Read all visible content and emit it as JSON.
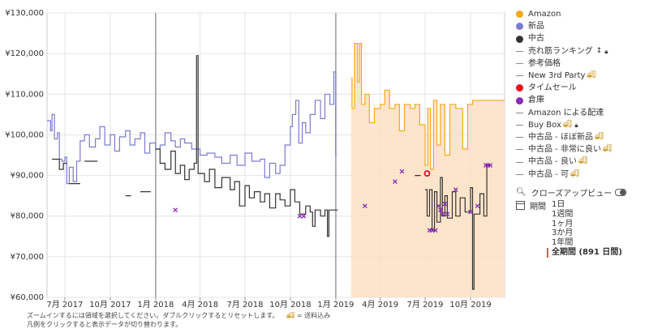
{
  "chart_data": {
    "type": "line",
    "yaxis": {
      "ticks": [
        60000,
        70000,
        80000,
        90000,
        100000,
        110000,
        120000,
        130000
      ],
      "tick_labels": [
        "¥60,000",
        "¥70,000",
        "¥80,000",
        "¥90,000",
        "¥100,000",
        "¥110,000",
        "¥120,000",
        "¥130,000"
      ],
      "ylim": [
        60000,
        130000
      ]
    },
    "xaxis": {
      "start": "2017-05-26",
      "end": "2019-12-09",
      "tick_dates": [
        "2017-07-01",
        "2017-10-01",
        "2018-01-01",
        "2018-04-01",
        "2018-07-01",
        "2018-10-01",
        "2019-01-01",
        "2019-04-01",
        "2019-07-01",
        "2019-10-01"
      ],
      "tick_labels": [
        "7月 2017",
        "10月 2017",
        "1月 2018",
        "4月 2018",
        "7月 2018",
        "10月 2018",
        "1月 2019",
        "4月 2019",
        "7月 2019",
        "10月 2019"
      ],
      "year_separators": [
        "2018-01-01",
        "2019-01-01"
      ]
    },
    "grid": true,
    "series": [
      {
        "name": "新品",
        "color": "#7b7bd1",
        "points": [
          [
            "2017-05-26",
            103500
          ],
          [
            "2017-06-02",
            101000
          ],
          [
            "2017-06-05",
            105000
          ],
          [
            "2017-06-10",
            99000
          ],
          [
            "2017-06-16",
            100500
          ],
          [
            "2017-06-20",
            94000
          ],
          [
            "2017-06-25",
            93500
          ],
          [
            "2017-07-01",
            94500
          ],
          [
            "2017-07-05",
            88000
          ],
          [
            "2017-07-10",
            92000
          ],
          [
            "2017-07-18",
            88500
          ],
          [
            "2017-07-25",
            93500
          ],
          [
            "2017-08-01",
            98500
          ],
          [
            "2017-08-10",
            100000
          ],
          [
            "2017-08-20",
            97000
          ],
          [
            "2017-09-01",
            99000
          ],
          [
            "2017-09-10",
            102000
          ],
          [
            "2017-09-20",
            97500
          ],
          [
            "2017-10-01",
            100000
          ],
          [
            "2017-10-10",
            96000
          ],
          [
            "2017-10-20",
            99500
          ],
          [
            "2017-11-01",
            101000
          ],
          [
            "2017-11-10",
            97500
          ],
          [
            "2017-11-20",
            99000
          ],
          [
            "2017-12-01",
            100500
          ],
          [
            "2017-12-10",
            95500
          ],
          [
            "2017-12-20",
            98000
          ],
          [
            "2018-01-01",
            96500
          ],
          [
            "2018-01-10",
            97500
          ],
          [
            "2018-01-20",
            100500
          ],
          [
            "2018-02-01",
            98500
          ],
          [
            "2018-02-10",
            97000
          ],
          [
            "2018-02-20",
            99000
          ],
          [
            "2018-03-01",
            98000
          ],
          [
            "2018-03-15",
            96500
          ],
          [
            "2018-04-01",
            95000
          ],
          [
            "2018-04-15",
            95500
          ],
          [
            "2018-05-01",
            94500
          ],
          [
            "2018-05-15",
            93000
          ],
          [
            "2018-06-01",
            95000
          ],
          [
            "2018-06-15",
            92500
          ],
          [
            "2018-07-01",
            95500
          ],
          [
            "2018-07-15",
            93500
          ],
          [
            "2018-08-01",
            94000
          ],
          [
            "2018-08-10",
            89500
          ],
          [
            "2018-08-20",
            93000
          ],
          [
            "2018-09-01",
            90500
          ],
          [
            "2018-09-10",
            92500
          ],
          [
            "2018-09-20",
            97500
          ],
          [
            "2018-10-01",
            102000
          ],
          [
            "2018-10-05",
            105000
          ],
          [
            "2018-10-12",
            108500
          ],
          [
            "2018-10-18",
            98000
          ],
          [
            "2018-10-25",
            103000
          ],
          [
            "2018-11-01",
            100500
          ],
          [
            "2018-11-10",
            105000
          ],
          [
            "2018-11-20",
            108500
          ],
          [
            "2018-12-01",
            104000
          ],
          [
            "2018-12-10",
            110000
          ],
          [
            "2018-12-20",
            107500
          ],
          [
            "2018-12-28",
            115500
          ],
          [
            "2019-01-01",
            95000
          ],
          [
            "2019-01-03",
            95000
          ]
        ]
      },
      {
        "name": "中古",
        "color": "#333333",
        "points": [
          [
            "2017-06-05",
            94000
          ],
          [
            "2017-06-20",
            91500
          ],
          [
            "2017-06-28",
            93000
          ],
          [
            "2017-07-05",
            null
          ],
          [
            "2017-07-10",
            88000
          ],
          [
            "2017-07-25",
            88000
          ],
          [
            "2017-08-01",
            null
          ],
          [
            "2017-08-10",
            93500
          ],
          [
            "2017-09-01",
            93500
          ],
          [
            "2017-09-05",
            null
          ],
          [
            "2017-11-01",
            85000
          ],
          [
            "2017-11-10",
            85000
          ],
          [
            "2017-11-12",
            null
          ],
          [
            "2017-12-01",
            86000
          ],
          [
            "2017-12-20",
            86000
          ],
          [
            "2017-12-22",
            null
          ],
          [
            "2018-01-01",
            96500
          ],
          [
            "2018-01-10",
            93000
          ],
          [
            "2018-01-20",
            91500
          ],
          [
            "2018-02-01",
            96000
          ],
          [
            "2018-02-10",
            90500
          ],
          [
            "2018-02-20",
            92500
          ],
          [
            "2018-03-01",
            89000
          ],
          [
            "2018-03-10",
            91500
          ],
          [
            "2018-03-20",
            93000
          ],
          [
            "2018-03-25",
            119500
          ],
          [
            "2018-03-28",
            90500
          ],
          [
            "2018-04-10",
            88500
          ],
          [
            "2018-04-20",
            91500
          ],
          [
            "2018-05-01",
            87000
          ],
          [
            "2018-05-15",
            89500
          ],
          [
            "2018-06-01",
            86500
          ],
          [
            "2018-06-10",
            88500
          ],
          [
            "2018-06-20",
            82500
          ],
          [
            "2018-07-01",
            87500
          ],
          [
            "2018-07-10",
            84500
          ],
          [
            "2018-07-20",
            86000
          ],
          [
            "2018-08-01",
            83500
          ],
          [
            "2018-08-10",
            85500
          ],
          [
            "2018-08-20",
            82000
          ],
          [
            "2018-09-01",
            85500
          ],
          [
            "2018-09-10",
            84000
          ],
          [
            "2018-09-20",
            82500
          ],
          [
            "2018-10-01",
            86500
          ],
          [
            "2018-10-10",
            83500
          ],
          [
            "2018-10-20",
            80500
          ],
          [
            "2018-11-01",
            82500
          ],
          [
            "2018-11-10",
            81000
          ],
          [
            "2018-11-15",
            77500
          ],
          [
            "2018-11-20",
            81500
          ],
          [
            "2018-12-01",
            80000
          ],
          [
            "2018-12-10",
            81500
          ],
          [
            "2018-12-15",
            75000
          ],
          [
            "2018-12-18",
            81500
          ],
          [
            "2019-01-01",
            81500
          ],
          [
            "2019-01-05",
            null
          ],
          [
            "2019-06-10",
            90000
          ],
          [
            "2019-06-20",
            90000
          ],
          [
            "2019-06-22",
            null
          ],
          [
            "2019-07-01",
            86500
          ],
          [
            "2019-07-05",
            80000
          ],
          [
            "2019-07-10",
            86500
          ],
          [
            "2019-07-15",
            76500
          ],
          [
            "2019-07-20",
            86000
          ],
          [
            "2019-07-25",
            78500
          ],
          [
            "2019-08-01",
            89500
          ],
          [
            "2019-08-05",
            80000
          ],
          [
            "2019-08-10",
            85000
          ],
          [
            "2019-08-15",
            79500
          ],
          [
            "2019-08-25",
            86000
          ],
          [
            "2019-09-01",
            80000
          ],
          [
            "2019-09-10",
            84500
          ],
          [
            "2019-09-20",
            81000
          ],
          [
            "2019-10-01",
            87000
          ],
          [
            "2019-10-05",
            62000
          ],
          [
            "2019-10-08",
            80500
          ],
          [
            "2019-10-20",
            85500
          ],
          [
            "2019-10-28",
            80000
          ],
          [
            "2019-11-03",
            92500
          ],
          [
            "2019-11-08",
            92500
          ],
          [
            "2019-11-12",
            null
          ]
        ]
      },
      {
        "name": "Amazon",
        "color": "#f7a81b",
        "fill": "#fde0c2",
        "points": [
          [
            "2019-02-01",
            114000
          ],
          [
            "2019-02-03",
            106500
          ],
          [
            "2019-02-08",
            122500
          ],
          [
            "2019-02-14",
            113000
          ],
          [
            "2019-02-18",
            122500
          ],
          [
            "2019-02-22",
            107500
          ],
          [
            "2019-03-01",
            110000
          ],
          [
            "2019-03-10",
            103000
          ],
          [
            "2019-03-20",
            106500
          ],
          [
            "2019-04-01",
            107500
          ],
          [
            "2019-04-10",
            111000
          ],
          [
            "2019-04-20",
            106500
          ],
          [
            "2019-05-01",
            107500
          ],
          [
            "2019-05-10",
            101000
          ],
          [
            "2019-05-20",
            107500
          ],
          [
            "2019-06-01",
            106500
          ],
          [
            "2019-06-10",
            107500
          ],
          [
            "2019-06-20",
            102500
          ],
          [
            "2019-07-01",
            92500
          ],
          [
            "2019-07-06",
            106500
          ],
          [
            "2019-07-12",
            91500
          ],
          [
            "2019-07-18",
            108500
          ],
          [
            "2019-07-25",
            97500
          ],
          [
            "2019-08-01",
            107500
          ],
          [
            "2019-08-10",
            95000
          ],
          [
            "2019-08-20",
            107500
          ],
          [
            "2019-09-01",
            106500
          ],
          [
            "2019-09-15",
            96500
          ],
          [
            "2019-09-25",
            107500
          ],
          [
            "2019-10-05",
            108500
          ],
          [
            "2019-12-09",
            108500
          ]
        ]
      }
    ],
    "markers": {
      "倉庫": {
        "color": "#8a2ab5",
        "points": [
          [
            "2018-02-10",
            81500
          ],
          [
            "2018-10-20",
            80000
          ],
          [
            "2018-10-28",
            80000
          ],
          [
            "2019-03-01",
            82500
          ],
          [
            "2019-05-01",
            88500
          ],
          [
            "2019-05-15",
            91000
          ],
          [
            "2019-07-10",
            76500
          ],
          [
            "2019-07-15",
            76500
          ],
          [
            "2019-07-22",
            76500
          ],
          [
            "2019-07-28",
            82500
          ],
          [
            "2019-08-01",
            81500
          ],
          [
            "2019-08-05",
            80500
          ],
          [
            "2019-08-10",
            83000
          ],
          [
            "2019-08-15",
            80500
          ],
          [
            "2019-09-01",
            86500
          ],
          [
            "2019-10-01",
            81000
          ],
          [
            "2019-10-15",
            82500
          ],
          [
            "2019-11-01",
            92500
          ],
          [
            "2019-11-05",
            92500
          ],
          [
            "2019-11-10",
            92500
          ]
        ]
      },
      "タイムセール": {
        "color": "#e8101e",
        "points": [
          [
            "2019-07-05",
            90500
          ]
        ]
      }
    }
  },
  "legend": [
    {
      "label": "Amazon",
      "marker": "dot",
      "color": "#f7a81b"
    },
    {
      "label": "新品",
      "marker": "dot",
      "color": "#7b7bd1"
    },
    {
      "label": "中古",
      "marker": "dot",
      "color": "#333333"
    },
    {
      "label": "売れ筋ランキング",
      "marker": "dash",
      "rank_icon": "ranking-sort-icon",
      "lock": true
    },
    {
      "label": "参考価格",
      "marker": "dash"
    },
    {
      "label": "New 3rd Party",
      "marker": "dash",
      "truck": true
    },
    {
      "label": "タイムセール",
      "marker": "dot",
      "color": "#e8101e"
    },
    {
      "label": "倉庫",
      "marker": "dot",
      "color": "#8a2ab5"
    },
    {
      "label": "Amazon による配達",
      "marker": "dash"
    },
    {
      "label": "Buy Box",
      "marker": "dash",
      "truck": true,
      "lock": true
    },
    {
      "label": "中古品 - ほぼ新品",
      "marker": "dash",
      "truck": true
    },
    {
      "label": "中古品 - 非常に良い",
      "marker": "dash",
      "truck": true
    },
    {
      "label": "中古品 - 良い",
      "marker": "dash",
      "truck": true
    },
    {
      "label": "中古品 - 可",
      "marker": "dash",
      "truck": true
    }
  ],
  "zoom": {
    "label": "クローズアップビュー"
  },
  "period": {
    "label": "期間",
    "options": [
      "1日",
      "1週間",
      "1ヶ月",
      "3か月",
      "1年間",
      "全期間 (891 日間)"
    ],
    "selected_index": 5
  },
  "hints": {
    "line1": "ズームインするには領域を選択してください。ダブルクリックするとリセットします。",
    "truck_note": "= 送料込み",
    "line2": "凡例をクリックすると表示データが切り替わります。"
  }
}
